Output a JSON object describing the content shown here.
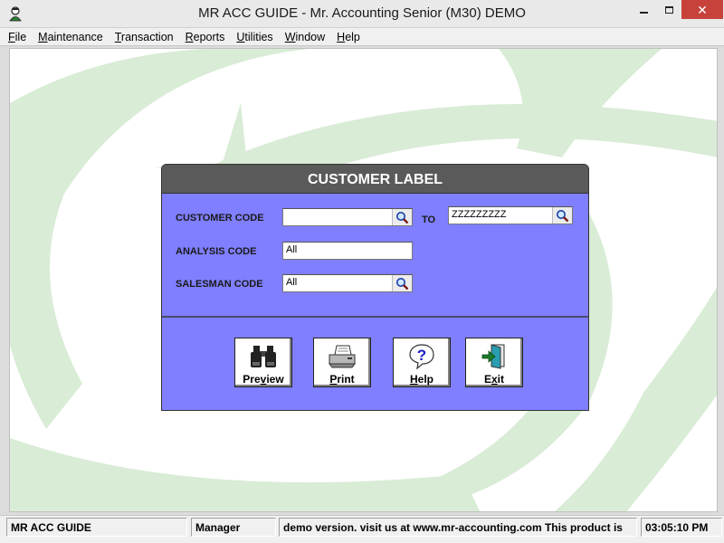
{
  "window": {
    "title": "MR ACC GUIDE - Mr. Accounting Senior (M30) DEMO",
    "min_icon": "minimize-icon",
    "max_icon": "maximize-icon",
    "close_icon": "close-icon",
    "close_color": "#c7423a"
  },
  "menu": [
    {
      "acc": "F",
      "rest": "ile"
    },
    {
      "acc": "M",
      "rest": "aintenance"
    },
    {
      "acc": "T",
      "rest": "ransaction"
    },
    {
      "acc": "R",
      "rest": "eports"
    },
    {
      "acc": "U",
      "rest": "tilities"
    },
    {
      "acc": "W",
      "rest": "indow"
    },
    {
      "acc": "H",
      "rest": "elp"
    }
  ],
  "dialog": {
    "title": "CUSTOMER LABEL",
    "header_color": "#5a5a5a",
    "body_color": "#7f7fff",
    "customer_code": {
      "label": "CUSTOMER CODE",
      "from_value": "",
      "to_label": "TO",
      "to_value": "ZZZZZZZZZ"
    },
    "analysis_code": {
      "label": "ANALYSIS CODE",
      "value": "All"
    },
    "salesman_code": {
      "label": "SALESMAN CODE",
      "value": "All"
    },
    "buttons": {
      "preview": {
        "acc": "",
        "pre": "Pre",
        "u": "v",
        "post": "iew",
        "icon": "binoculars-icon"
      },
      "print": {
        "pre": "",
        "u": "P",
        "post": "rint",
        "icon": "printer-icon"
      },
      "help": {
        "pre": "",
        "u": "H",
        "post": "elp",
        "icon": "help-icon"
      },
      "exit": {
        "pre": "E",
        "u": "x",
        "post": "it",
        "icon": "exit-door-icon"
      }
    }
  },
  "statusbar": {
    "app": "MR ACC GUIDE",
    "user": "Manager",
    "message": "demo version.  visit us at www.mr-accounting.com This product is",
    "time": "03:05:10 PM"
  }
}
